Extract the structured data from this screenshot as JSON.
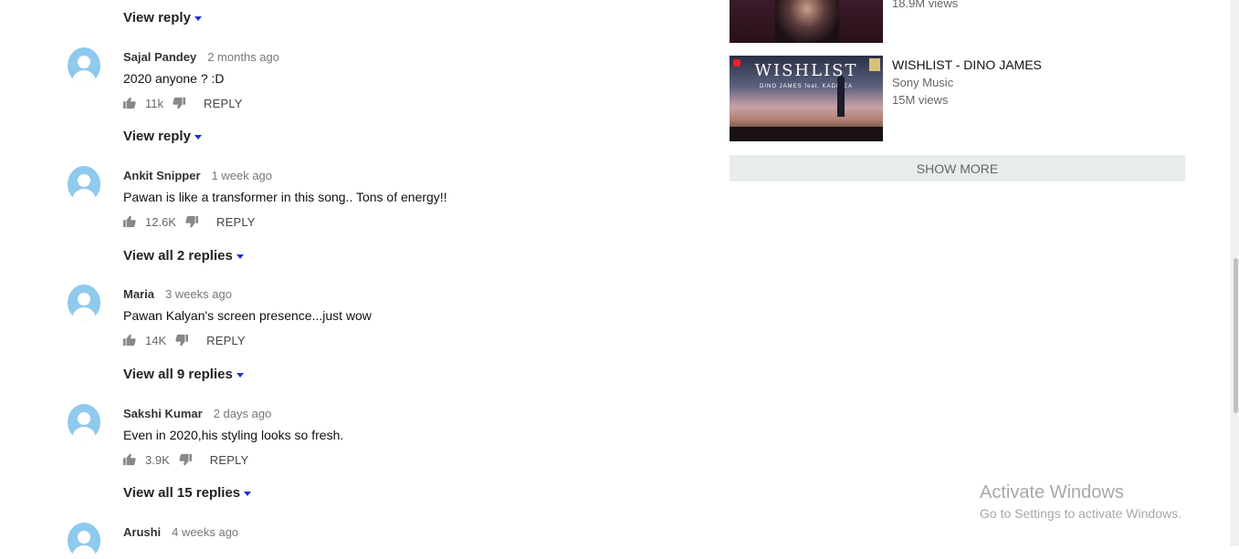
{
  "comments": [
    {
      "author": "Sajal Pandey",
      "time": "2 months ago",
      "text": "2020 anyone ? :D",
      "likes": "11k",
      "reply": "REPLY",
      "view_replies": "View reply"
    },
    {
      "author": "Ankit Snipper",
      "time": "1 week ago",
      "text": "Pawan is like a transformer in this song.. Tons of energy!!",
      "likes": "12.6K",
      "reply": "REPLY",
      "view_replies": "View all 2 replies"
    },
    {
      "author": "Maria",
      "time": "3 weeks ago",
      "text": "Pawan Kalyan's screen presence...just wow",
      "likes": "14K",
      "reply": "REPLY",
      "view_replies": "View all 9 replies"
    },
    {
      "author": "Sakshi Kumar",
      "time": "2 days ago",
      "text": "Even in 2020,his styling looks so fresh.",
      "likes": "3.9K",
      "reply": "REPLY",
      "view_replies": "View all 15 replies"
    },
    {
      "author": "Arushi",
      "time": "4 weeks ago"
    }
  ],
  "top_view_reply": "View reply",
  "sidebar": {
    "prev_views": "18.9M views",
    "video": {
      "title": "WISHLIST - DINO JAMES",
      "channel": "Sony Music",
      "views": "15M views",
      "thumb_text": "WISHLIST",
      "thumb_sub": "DINO JAMES feat. KADRIEA"
    },
    "show_more": "SHOW MORE"
  },
  "windows_watermark": {
    "title": "Activate Windows",
    "subtitle": "Go to Settings to activate Windows."
  },
  "colors": {
    "avatar": "#8ec9ee",
    "caret": "#1a2fd6",
    "show_more_bg": "#e9ecec"
  }
}
